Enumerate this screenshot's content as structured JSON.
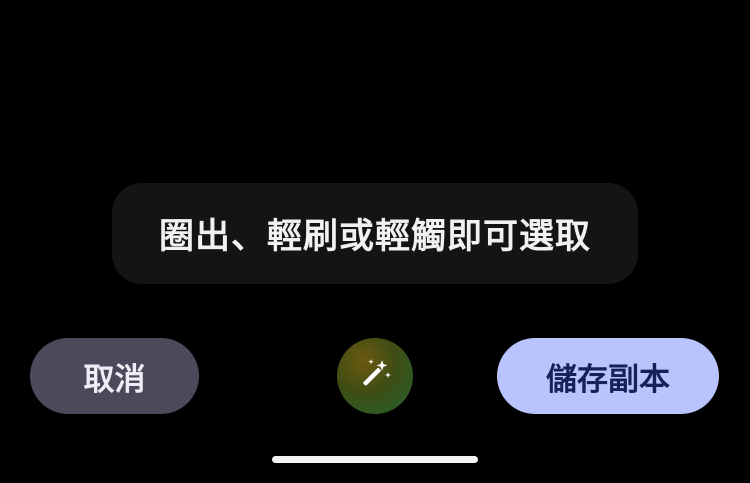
{
  "hint": {
    "text": "圈出、輕刷或輕觸即可選取"
  },
  "actions": {
    "cancel_label": "取消",
    "save_label": "儲存副本",
    "magic_icon": "magic-wand-icon"
  },
  "colors": {
    "background": "#000000",
    "hint_pill": "#141414",
    "cancel_button": "#4a4a5b",
    "save_button": "#b9c4ff",
    "save_text": "#14215a"
  }
}
